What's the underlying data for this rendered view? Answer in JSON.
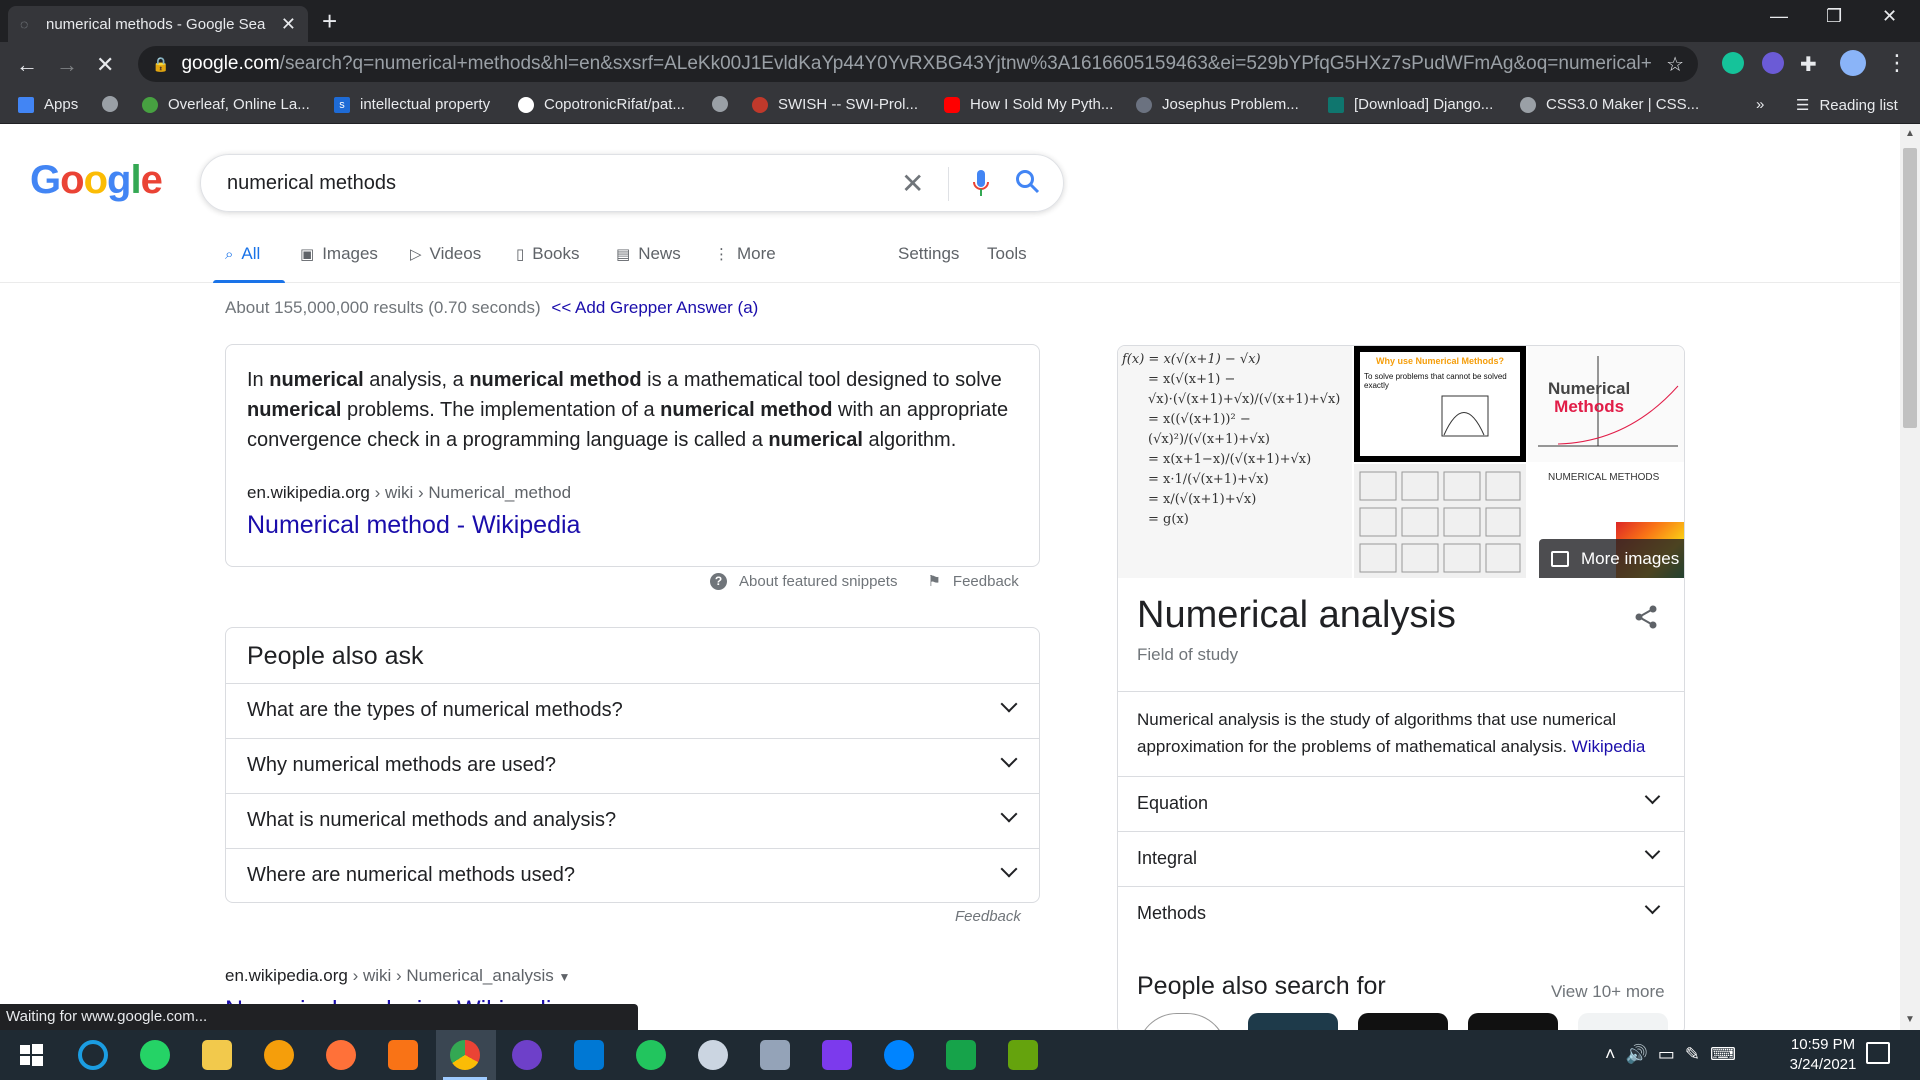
{
  "browser": {
    "tab_title": "numerical methods - Google Sea",
    "new_tab": "+",
    "url_host": "google.com",
    "url_path": "/search?q=numerical+methods&hl=en&sxsrf=ALeKk00J1EvldKaYp44Y0YvRXBG43Yjtnw%3A1616605159463&ei=529bYPfqG5HXz7sPudWFmAg&oq=numerical+methods&gs_lcp...",
    "bookmarks": [
      {
        "label": "Apps",
        "color": "#4285f4"
      },
      {
        "label": "",
        "color": "#9aa0a6"
      },
      {
        "label": "Overleaf, Online La...",
        "color": "#47a141"
      },
      {
        "label": "intellectual property",
        "color": "#1e6bd6"
      },
      {
        "label": "CopotronicRifat/pat...",
        "color": "#ffffff"
      },
      {
        "label": "",
        "color": "#9aa0a6"
      },
      {
        "label": "SWISH -- SWI-Prol...",
        "color": "#c0392b"
      },
      {
        "label": "How I Sold My Pyth...",
        "color": "#ff0000"
      },
      {
        "label": "Josephus Problem...",
        "color": "#6b7280"
      },
      {
        "label": "[Download] Django...",
        "color": "#0f766e"
      },
      {
        "label": "CSS3.0 Maker | CSS...",
        "color": "#9aa0a6"
      }
    ],
    "bookmarks_more": "»",
    "reading_list": "Reading list",
    "status_text": "Waiting for www.google.com..."
  },
  "google": {
    "logo": "Google",
    "query": "numerical methods",
    "tabs": [
      {
        "label": "All",
        "icon": "search-icon",
        "active": true
      },
      {
        "label": "Images",
        "icon": "image-icon"
      },
      {
        "label": "Videos",
        "icon": "play-icon"
      },
      {
        "label": "Books",
        "icon": "book-icon"
      },
      {
        "label": "News",
        "icon": "news-icon"
      },
      {
        "label": "More",
        "icon": "dots-vertical-icon"
      }
    ],
    "settings": "Settings",
    "tools": "Tools",
    "stats": "About 155,000,000 results (0.70 seconds)",
    "grepper": "<< Add Grepper Answer (a)",
    "snippet": {
      "parts": [
        "In ",
        "numerical",
        " analysis, a ",
        "numerical method",
        " is a mathematical tool designed to solve ",
        "numerical",
        " problems. The implementation of a ",
        "numerical method",
        " with an appropriate convergence check in a programming language is called a ",
        "numerical",
        " algorithm."
      ],
      "cite_host": "en.wikipedia.org",
      "cite_path": " › wiki › Numerical_method",
      "title": "Numerical method - Wikipedia",
      "about": "About featured snippets",
      "feedback": "Feedback"
    },
    "paa": {
      "heading": "People also ask",
      "questions": [
        "What are the types of numerical methods?",
        "Why numerical methods are used?",
        "What is numerical methods and analysis?",
        "Where are numerical methods used?"
      ],
      "feedback": "Feedback"
    },
    "next_result": {
      "cite_host": "en.wikipedia.org",
      "cite_path": " › wiki › Numerical_analysis",
      "title": "Numerical analysis - Wikipedia"
    },
    "knowledge_panel": {
      "img2_title": "Why use Numerical Methods?",
      "img2_text": "To solve problems that cannot be solved exactly",
      "img3_title_1": "Numerical",
      "img3_title_2": "Methods",
      "img5_title": "NUMERICAL METHODS",
      "more_images": "More images",
      "title": "Numerical analysis",
      "subtitle": "Field of study",
      "description": "Numerical analysis is the study of algorithms that use numerical approximation for the problems of mathematical analysis.",
      "source": "Wikipedia",
      "rows": [
        "Equation",
        "Integral",
        "Methods"
      ],
      "people_also_search": "People also search for",
      "view_more": "View 10+ more"
    }
  },
  "taskbar": {
    "time": "10:59 PM",
    "date": "3/24/2021"
  }
}
